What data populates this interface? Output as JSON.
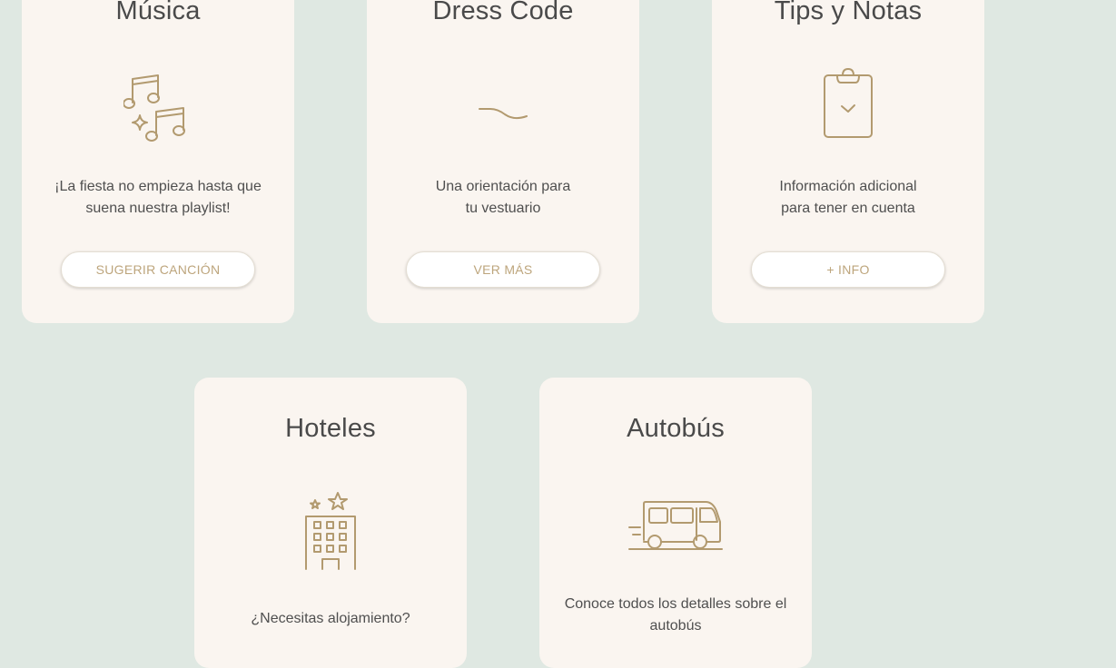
{
  "cards": {
    "musica": {
      "title": "Música",
      "icon": "music-notes-icon",
      "text_line1": "¡La fiesta no empieza hasta que",
      "text_line2": "suena nuestra playlist!",
      "button": "SUGERIR CANCIÓN"
    },
    "dress_code": {
      "title": "Dress Code",
      "icon": "tilde-line-icon",
      "text_line1": "Una orientación para",
      "text_line2": "tu vestuario",
      "button": "VER MÁS"
    },
    "tips": {
      "title": "Tips y Notas",
      "icon": "clipboard-check-icon",
      "text_line1": "Información adicional",
      "text_line2": "para tener en cuenta",
      "button": "+ INFO"
    },
    "hoteles": {
      "title": "Hoteles",
      "icon": "hotel-building-icon",
      "text_line1": "¿Necesitas alojamiento?"
    },
    "autobus": {
      "title": "Autobús",
      "icon": "bus-icon",
      "text_line1": "Conoce todos los detalles sobre el",
      "text_line2": "autobús"
    }
  },
  "colors": {
    "background": "#dfe8e2",
    "card": "#faf5f0",
    "accent": "#b29a6f",
    "button_text": "#bda57c",
    "title_text": "#4a4a4a"
  }
}
